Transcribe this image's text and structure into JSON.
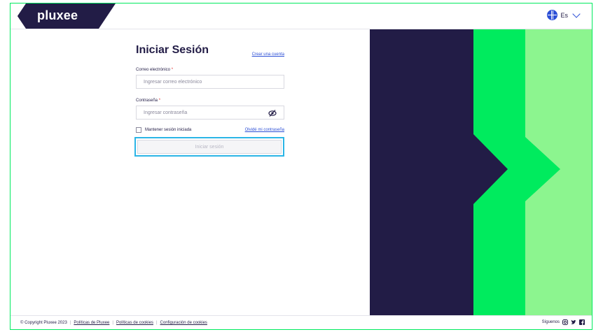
{
  "header": {
    "logo_text": "pluxee",
    "language_label": "Es"
  },
  "login": {
    "title": "Iniciar Sesión",
    "create_account_link": "Crear una cuenta",
    "email_label": "Correo electrónico",
    "email_placeholder": "Ingresar correo electrónico",
    "password_label": "Contraseña",
    "password_placeholder": "Ingresar contraseña",
    "required_mark": "*",
    "remember_label": "Mantener sesión iniciada",
    "forgot_link": "Olvidé mi contraseña",
    "submit_label": "Iniciar sesión"
  },
  "footer": {
    "copyright": "© Copyright Pluxee 2023",
    "separator": "|",
    "links": [
      "Políticas de Pluxee",
      "Políticas de cookies",
      "Configuración de cookies"
    ],
    "follow_label": "Síguenos"
  },
  "colors": {
    "navy": "#221c46",
    "brand_green": "#00eb5e",
    "light_green": "#8cf58f",
    "link_blue": "#2c4fd6",
    "focus_cyan": "#2bb5e6"
  },
  "icons": [
    "globe-icon",
    "chevron-down-icon",
    "eye-slash-icon",
    "instagram-icon",
    "twitter-icon",
    "facebook-icon"
  ]
}
